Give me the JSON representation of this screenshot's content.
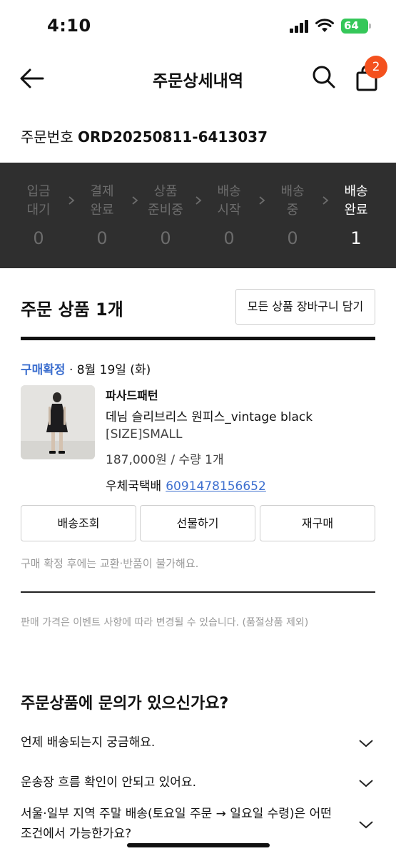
{
  "status_bar": {
    "time": "4:10",
    "battery": "64"
  },
  "header": {
    "title": "주문상세내역",
    "cart_count": "2"
  },
  "order": {
    "label": "주문번호",
    "number": "ORD20250811-6413037"
  },
  "progress_steps": [
    {
      "label": "입금\n대기",
      "count": "0",
      "active": false
    },
    {
      "label": "결제\n완료",
      "count": "0",
      "active": false
    },
    {
      "label": "상품\n준비중",
      "count": "0",
      "active": false
    },
    {
      "label": "배송\n시작",
      "count": "0",
      "active": false
    },
    {
      "label": "배송\n중",
      "count": "0",
      "active": false
    },
    {
      "label": "배송\n완료",
      "count": "1",
      "active": true
    }
  ],
  "products_section": {
    "title": "주문 상품 1개",
    "add_all_label": "모든 상품 장바구니 담기"
  },
  "item": {
    "status": "구매확정",
    "date": " · 8월 19일 (화)",
    "brand": "파사드패턴",
    "name": "데님 슬리브리스 원피스_vintage black",
    "option": "[SIZE]SMALL",
    "price_qty": "187,000원 / 수량 1개",
    "courier": "우체국택배",
    "tracking_no": "6091478156652"
  },
  "actions": {
    "track": "배송조회",
    "gift": "선물하기",
    "reorder": "재구매"
  },
  "notice": "구매 확정 후에는 교환·반품이 불가해요.",
  "price_notice": "판매 가격은 이벤트 사항에 따라 변경될 수 있습니다. (품절상품 제외)",
  "faq": {
    "title": "주문상품에 문의가 있으신가요?",
    "items": [
      "언제 배송되는지 궁금해요.",
      "운송장 흐름 확인이 안되고 있어요.",
      "서울·일부 지역 주말 배송(토요일 주문 → 일요일 수령)은 어떤 조건에서 가능한가요?"
    ]
  },
  "colors": {
    "accent_blue": "#3d6fcf",
    "badge": "#f4511e",
    "progress_bg": "#2f2f2f"
  }
}
